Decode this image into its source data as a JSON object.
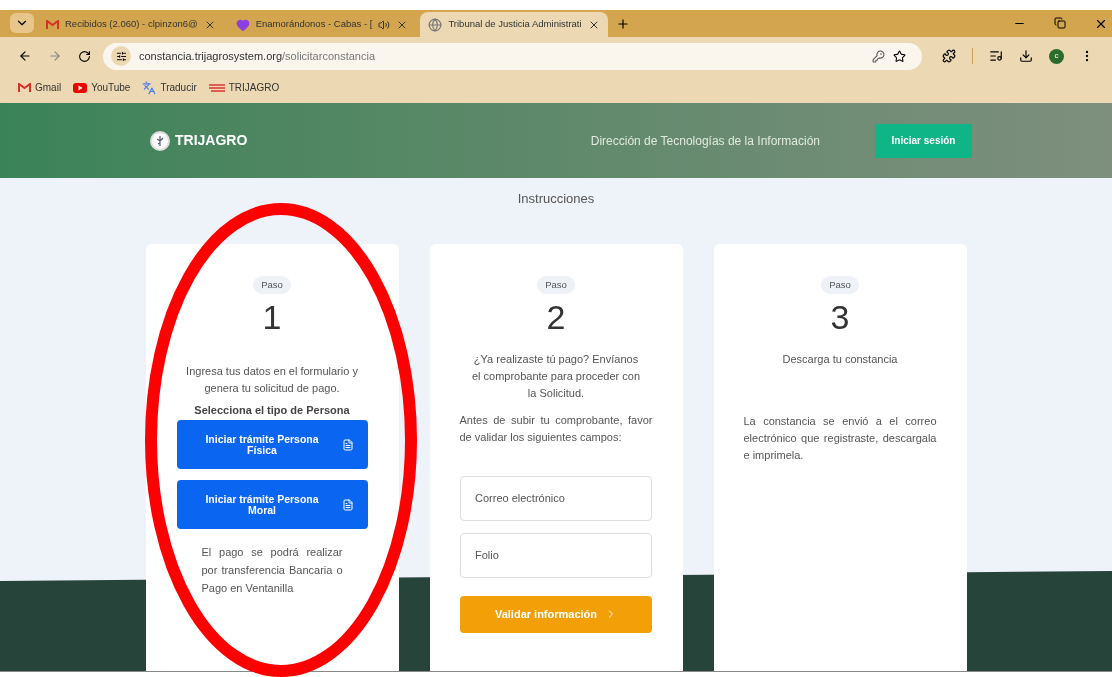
{
  "browser": {
    "tabs": [
      {
        "title": "Recibidos (2.060) - clpinzon6@",
        "selected": false,
        "audio": false
      },
      {
        "title": "Enamorándonos - Cabas - [",
        "selected": false,
        "audio": true
      },
      {
        "title": "Tribunal de Justicia Administrati",
        "selected": true,
        "audio": false
      }
    ],
    "address": {
      "host": "constancia.trijagrosystem.org",
      "path": "/solicitarconstancia"
    },
    "profile_initial": "c",
    "bookmarks": [
      {
        "label": "Gmail"
      },
      {
        "label": "YouTube"
      },
      {
        "label": "Traducir"
      },
      {
        "label": "TRIJAGRO"
      }
    ]
  },
  "header": {
    "brand": "TRIJAGRO",
    "subtitle": "Dirección de Tecnologías de la Información",
    "login": "Iniciar sesión"
  },
  "section_title": "Instrucciones",
  "steps": [
    {
      "badge": "Paso",
      "number": "1",
      "intro": "Ingresa tus datos en el formulario y genera tu solicitud de pago.",
      "subheading": "Selecciona el tipo de Persona",
      "buttons": [
        "Iniciar trámite Persona Física",
        "Iniciar trámite Persona Moral"
      ],
      "note": "El pago se podrá realizar por transferencia Bancaria o Pago en Ventanilla"
    },
    {
      "badge": "Paso",
      "number": "2",
      "intro": "¿Ya realizaste tú pago? Envíanos el comprobante para proceder con la Solicitud.",
      "note": "Antes de subir tu comprobante, favor de validar los siguientes campos:",
      "fields": [
        {
          "placeholder": "Correo electrónico"
        },
        {
          "placeholder": "Folio"
        }
      ],
      "submit": "Validar información"
    },
    {
      "badge": "Paso",
      "number": "3",
      "intro": "Descarga tu constancia",
      "note": "La constancia se envió a el correo electrónico que registraste, descargala e imprimela."
    }
  ]
}
